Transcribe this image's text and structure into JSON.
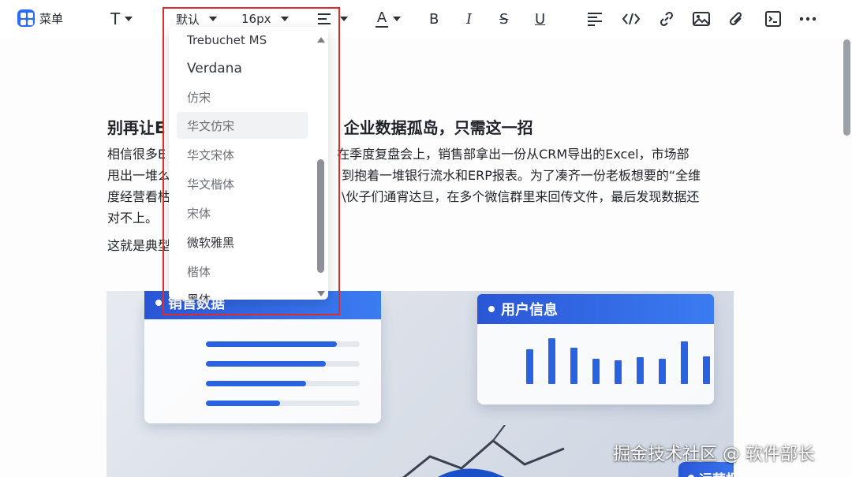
{
  "toolbar": {
    "menu_label": "菜单",
    "font_family_value": "默认",
    "font_size_value": "16px",
    "icons": [
      "text-style-icon",
      "align-icon",
      "font-color-icon",
      "bold-icon",
      "italic-icon",
      "strikethrough-icon",
      "underline-icon",
      "paragraph-format-icon",
      "code-icon",
      "link-icon",
      "image-icon",
      "attachment-icon",
      "code-block-icon",
      "more-icon"
    ],
    "bold_glyph": "B",
    "italic_glyph": "I",
    "strike_glyph": "S",
    "underline_glyph": "U",
    "font_color_glyph": "A",
    "text_glyph": "T"
  },
  "font_dropdown": {
    "items": [
      "Trebuchet MS",
      "Verdana",
      "仿宋",
      "华文仿宋",
      "华文宋体",
      "华文楷体",
      "宋体",
      "微软雅黑",
      "楷体",
      "黑体"
    ],
    "selected": "华文仿宋"
  },
  "article": {
    "title_left": "别再让E",
    "title_right": "企业数据孤岛，只需这一招",
    "para1_lines": [
      [
        "相信很多E",
        "在季度复盘会上，销售部拿出一份从CRM导出的Excel，市场部"
      ],
      [
        "甩出一堆么",
        "到抱着一堆银行流水和ERP报表。为了凑齐一份老板想要的“全维"
      ],
      [
        "度经营看枯",
        "\\伙子们通宵达旦，在多个微信群里来回传文件，最后发现数据还"
      ],
      [
        "对不上。",
        ""
      ]
    ],
    "para2": "这就是典型"
  },
  "hero": {
    "sales_card_title": "销售数据",
    "user_card_title": "用户信息",
    "ops_card_title": "运营报",
    "sales_bars": [
      0.85,
      0.78,
      0.65,
      0.48
    ],
    "user_bars": [
      0.55,
      0.72,
      0.58,
      0.4,
      0.38,
      0.42,
      0.4,
      0.68,
      0.44
    ]
  },
  "watermark": "掘金技术社区 @ 软件部长",
  "colors": {
    "accent": "#2b6cf6",
    "highlight": "#e02b2b"
  }
}
